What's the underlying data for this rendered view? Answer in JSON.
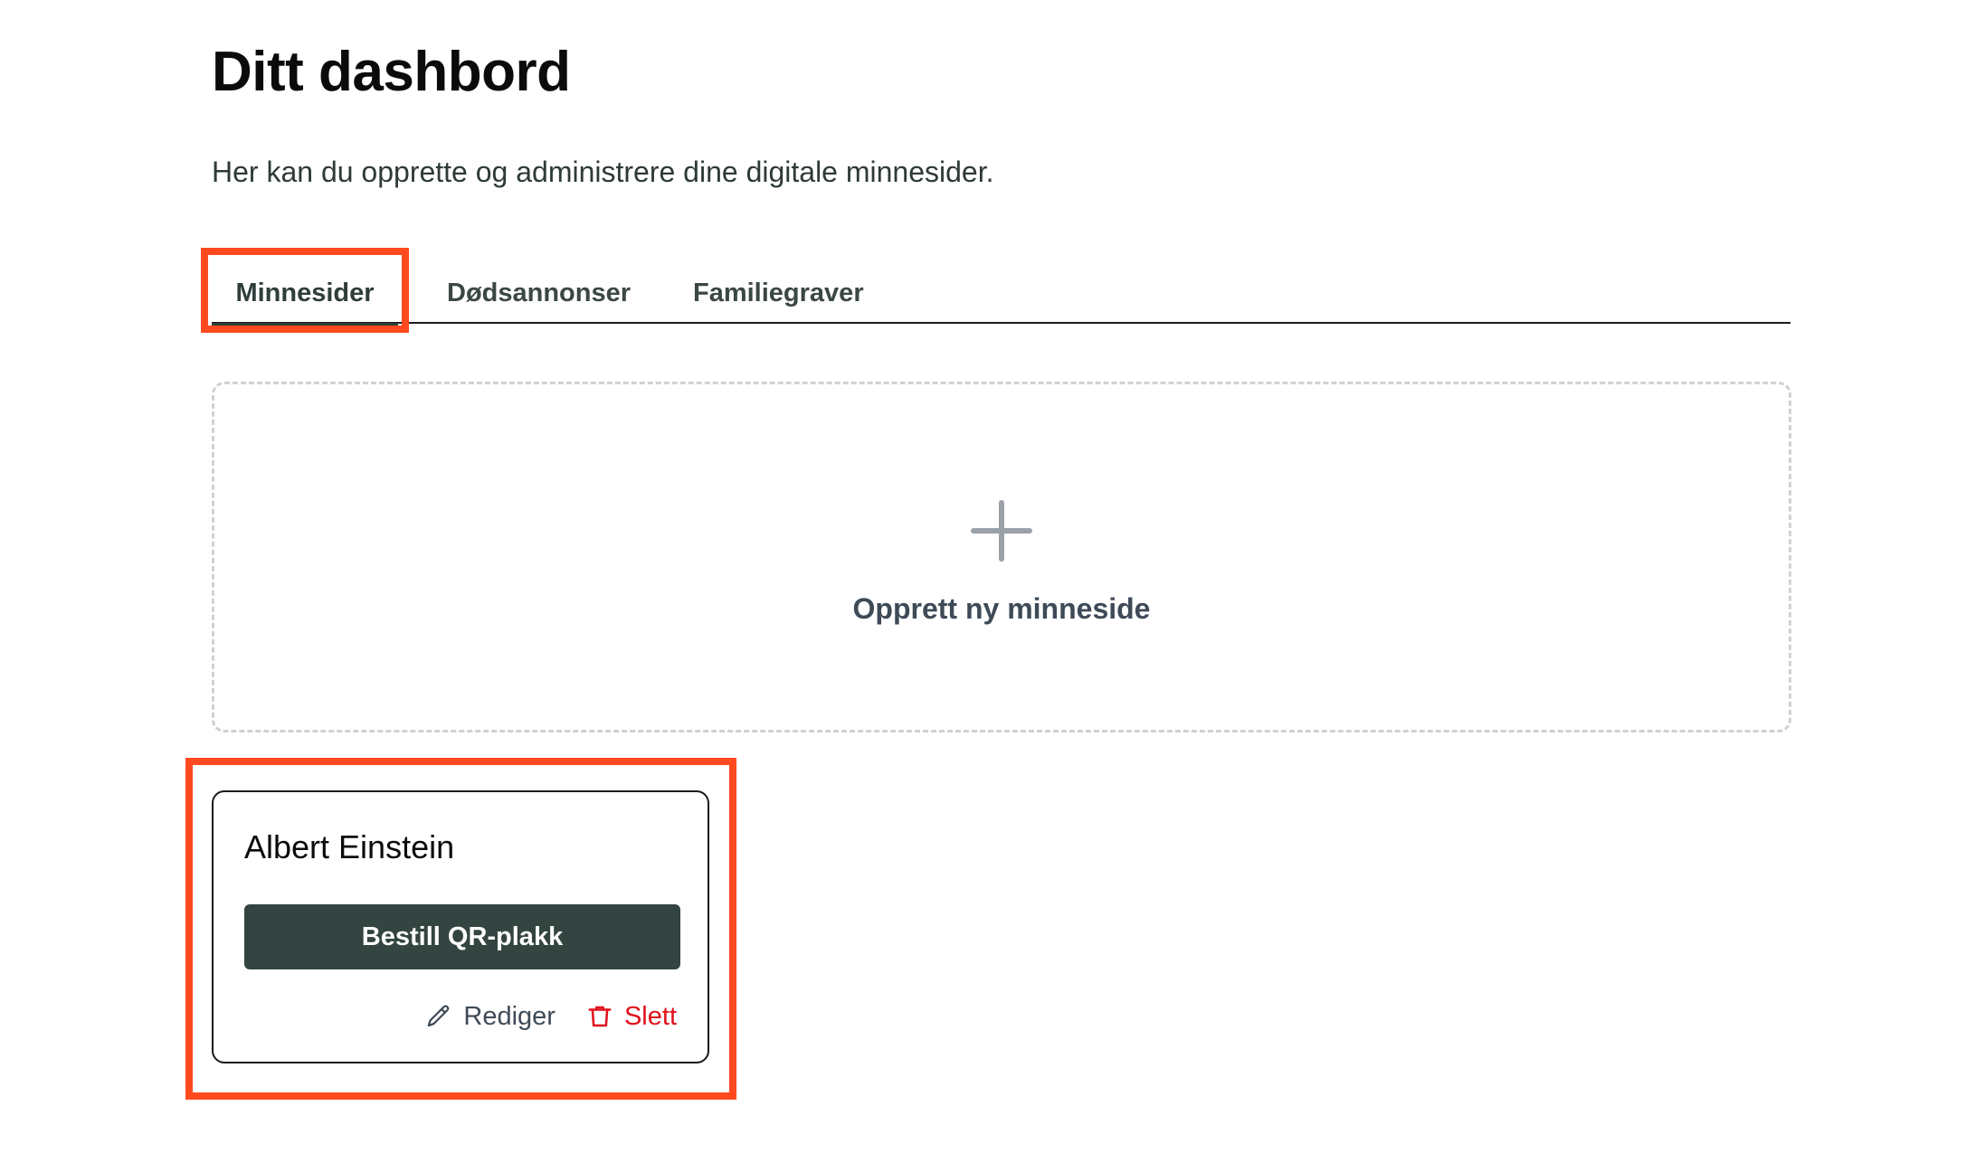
{
  "header": {
    "title": "Ditt dashbord",
    "subtitle": "Her kan du opprette og administrere dine digitale minnesider."
  },
  "tabs": [
    {
      "label": "Minnesider",
      "active": true
    },
    {
      "label": "Dødsannonser",
      "active": false
    },
    {
      "label": "Familiegraver",
      "active": false
    }
  ],
  "create_card": {
    "icon": "plus-icon",
    "label": "Opprett ny minneside"
  },
  "memorial_cards": [
    {
      "name": "Albert Einstein",
      "primary_button": "Bestill QR-plakk",
      "edit_label": "Rediger",
      "edit_icon": "pencil-icon",
      "delete_label": "Slett",
      "delete_icon": "trash-icon"
    }
  ],
  "colors": {
    "primary": "#334441",
    "danger": "#e0101a",
    "highlight": "#ff4a1f",
    "muted_icon": "#9aa1a8"
  }
}
